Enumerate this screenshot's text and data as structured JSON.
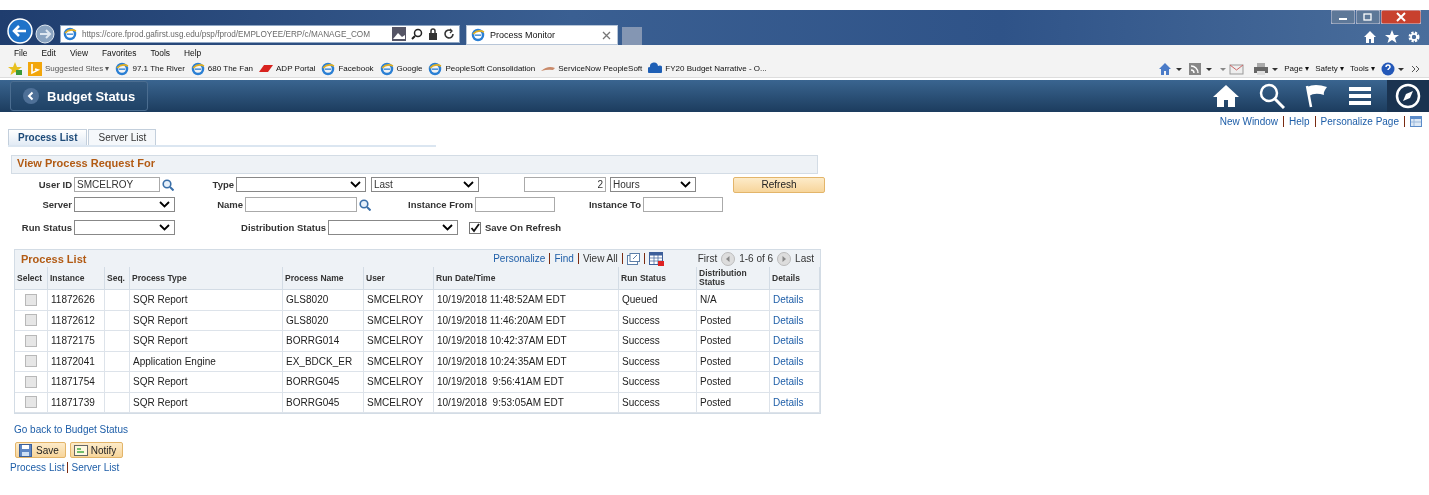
{
  "browser": {
    "address": "https://core.fprod.gafirst.usg.edu/psp/fprod/EMPLOYEE/ERP/c/MANAGE_COM",
    "tab_title": "Process Monitor",
    "menu": [
      "File",
      "Edit",
      "View",
      "Favorites",
      "Tools",
      "Help"
    ],
    "favorites": [
      {
        "label": "Suggested Sites ▾",
        "kind": "bing"
      },
      {
        "label": "97.1 The River",
        "kind": "ie"
      },
      {
        "label": "680 The Fan",
        "kind": "ie"
      },
      {
        "label": "ADP Portal",
        "kind": "adp"
      },
      {
        "label": "Facebook",
        "kind": "ie"
      },
      {
        "label": "Google",
        "kind": "ie"
      },
      {
        "label": "PeopleSoft Consolidation",
        "kind": "ie"
      },
      {
        "label": "ServiceNow PeopleSoft",
        "kind": "sn"
      },
      {
        "label": "FY20 Budget Narrative - O...",
        "kind": "cloud"
      }
    ],
    "command_bar": [
      "Page ▾",
      "Safety ▾",
      "Tools ▾"
    ]
  },
  "header": {
    "title": "Budget Status"
  },
  "page_links": [
    "New Window",
    "Help",
    "Personalize Page"
  ],
  "tabs": [
    {
      "label": "Process List",
      "selected": true
    },
    {
      "label": "Server List",
      "selected": false
    }
  ],
  "criteria": {
    "title": "View Process Request For",
    "rows": [
      [
        {
          "kind": "label",
          "label": "User ID"
        },
        {
          "kind": "lookup",
          "value": "SMCELROY"
        },
        {
          "kind": "label",
          "label": "Type"
        },
        {
          "kind": "select"
        },
        {
          "kind": "select",
          "value": "Last"
        },
        {
          "kind": "number",
          "value": "2"
        },
        {
          "kind": "select",
          "value": "Hours"
        },
        {
          "kind": "button",
          "label": "Refresh"
        }
      ],
      [
        {
          "kind": "label",
          "label": "Server"
        },
        {
          "kind": "select"
        },
        {
          "kind": "label",
          "label": "Name"
        },
        {
          "kind": "lookup"
        },
        {
          "kind": "label",
          "label": "Instance From"
        },
        {
          "kind": "text"
        },
        {
          "kind": "label",
          "label": "Instance To"
        },
        {
          "kind": "text"
        }
      ],
      [
        {
          "kind": "label",
          "label": "Run Status"
        },
        {
          "kind": "select"
        },
        {
          "kind": "label",
          "label": "Distribution Status"
        },
        {
          "kind": "select"
        },
        {
          "kind": "check",
          "label": "Save On Refresh",
          "checked": true
        }
      ]
    ]
  },
  "process_list": {
    "title": "Process List",
    "nav_links": [
      "Personalize",
      "Find"
    ],
    "view_all": "View All",
    "first": "First",
    "range": "1-6 of 6",
    "last": "Last",
    "select_column": "Select",
    "columns": [
      "Instance",
      "Seq.",
      "Process Type",
      "Process Name",
      "User",
      "Run Date/Time",
      "Run Status",
      "Distribution Status",
      "Details"
    ],
    "rows": [
      {
        "checked": false,
        "cells": [
          "11872626",
          "",
          "SQR Report",
          "GLS8020",
          "SMCELROY",
          "10/19/2018 11:48:52AM EDT",
          "Queued",
          "N/A",
          "Details"
        ]
      },
      {
        "checked": false,
        "cells": [
          "11872612",
          "",
          "SQR Report",
          "GLS8020",
          "SMCELROY",
          "10/19/2018 11:46:20AM EDT",
          "Success",
          "Posted",
          "Details"
        ]
      },
      {
        "checked": false,
        "cells": [
          "11872175",
          "",
          "SQR Report",
          "BORRG014",
          "SMCELROY",
          "10/19/2018 10:42:37AM EDT",
          "Success",
          "Posted",
          "Details"
        ]
      },
      {
        "checked": false,
        "cells": [
          "11872041",
          "",
          "Application Engine",
          "EX_BDCK_ER",
          "SMCELROY",
          "10/19/2018 10:24:35AM EDT",
          "Success",
          "Posted",
          "Details"
        ]
      },
      {
        "checked": false,
        "cells": [
          "11871754",
          "",
          "SQR Report",
          "BORRG045",
          "SMCELROY",
          "10/19/2018  9:56:41AM EDT",
          "Success",
          "Posted",
          "Details"
        ]
      },
      {
        "checked": false,
        "cells": [
          "11871739",
          "",
          "SQR Report",
          "BORRG045",
          "SMCELROY",
          "10/19/2018  9:53:05AM EDT",
          "Success",
          "Posted",
          "Details"
        ]
      }
    ]
  },
  "back_link": "Go back to Budget Status",
  "buttons": [
    {
      "label": "Save",
      "kind": "save"
    },
    {
      "label": "Notify",
      "kind": "notify"
    }
  ],
  "bottom_links": [
    "Process List",
    "Server List"
  ]
}
